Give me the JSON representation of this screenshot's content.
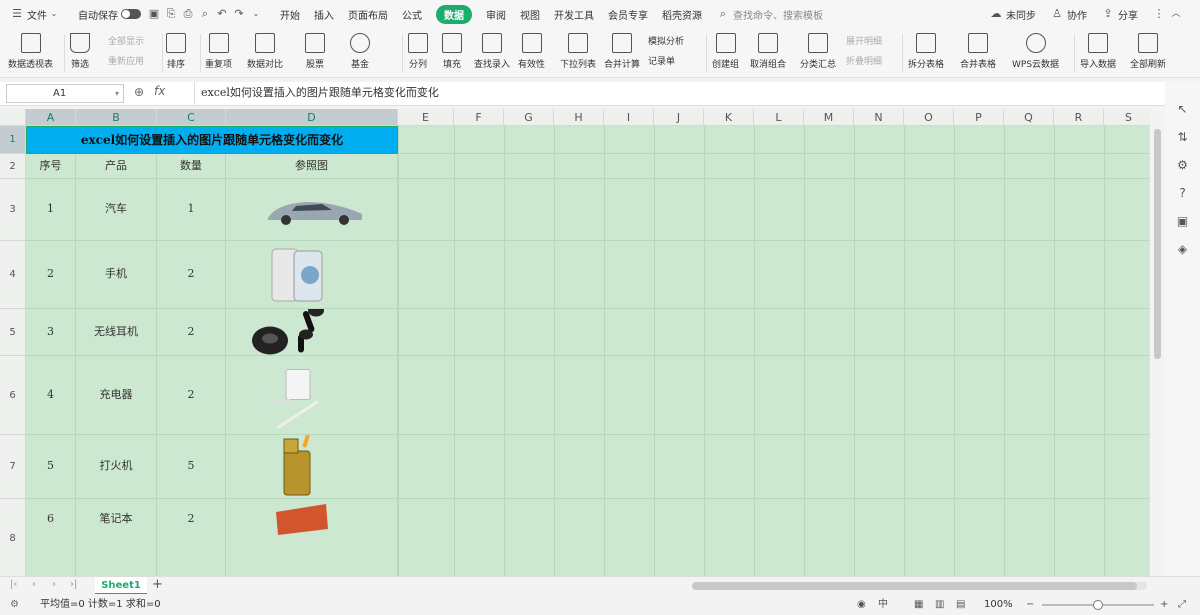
{
  "titlebar": {
    "menu_label": "文件",
    "autosave_label": "自动保存",
    "tabs": [
      "开始",
      "插入",
      "页面布局",
      "公式",
      "数据",
      "审阅",
      "视图",
      "开发工具",
      "会员专享",
      "稻壳资源"
    ],
    "active_tab": "数据",
    "search_placeholder": "查找命令、搜索模板",
    "sync_label": "未同步",
    "collab_label": "协作",
    "share_label": "分享"
  },
  "ribbon": {
    "pivot": "数据透视表",
    "filter": "筛选",
    "show_all": "全部显示",
    "reapply": "重新应用",
    "sort": "排序",
    "duplicates": "重复项",
    "compare": "数据对比",
    "stock": "股票",
    "fund": "基金",
    "split": "分列",
    "fill": "填充",
    "lookup": "查找录入",
    "validity": "有效性",
    "dropdown": "下拉列表",
    "consolidate": "合并计算",
    "simulate": "模拟分析",
    "record": "记录单",
    "group": "创建组",
    "ungroup": "取消组合",
    "subtotal": "分类汇总",
    "expand": "展开明细",
    "collapse": "折叠明细",
    "split_table": "拆分表格",
    "merge_table": "合并表格",
    "wps_cloud": "WPS云数据",
    "import": "导入数据",
    "refresh_all": "全部刷新"
  },
  "formula_bar": {
    "cell_ref": "A1",
    "fx": "fx",
    "content": "excel如何设置插入的图片跟随单元格变化而变化"
  },
  "sheet": {
    "columns": [
      "A",
      "B",
      "C",
      "D",
      "E",
      "F",
      "G",
      "H",
      "I",
      "J",
      "K",
      "L",
      "M",
      "N",
      "O",
      "P",
      "Q",
      "R",
      "S"
    ],
    "rows": [
      "1",
      "2",
      "3",
      "4",
      "5",
      "6",
      "7",
      "8"
    ],
    "title": "excel如何设置插入的图片跟随单元格变化而变化",
    "headers": [
      "序号",
      "产品",
      "数量",
      "参照图"
    ],
    "data": [
      {
        "no": "1",
        "product": "汽车",
        "qty": "1",
        "image": "car-image"
      },
      {
        "no": "2",
        "product": "手机",
        "qty": "2",
        "image": "phone-image"
      },
      {
        "no": "3",
        "product": "无线耳机",
        "qty": "2",
        "image": "earbuds-image"
      },
      {
        "no": "4",
        "product": "充电器",
        "qty": "2",
        "image": "charger-image"
      },
      {
        "no": "5",
        "product": "打火机",
        "qty": "5",
        "image": "lighter-image"
      },
      {
        "no": "6",
        "product": "笔记本",
        "qty": "2",
        "image": "laptop-image"
      }
    ]
  },
  "sheet_tabs": {
    "active": "Sheet1",
    "add": "+"
  },
  "status": {
    "summary": "平均值=0  计数=1  求和=0",
    "zoom": "100%",
    "zoom_level": 1.0
  },
  "colors": {
    "accent": "#1aad6b",
    "title_fill": "#00aeef",
    "grid_fill": "#cde8d0"
  }
}
